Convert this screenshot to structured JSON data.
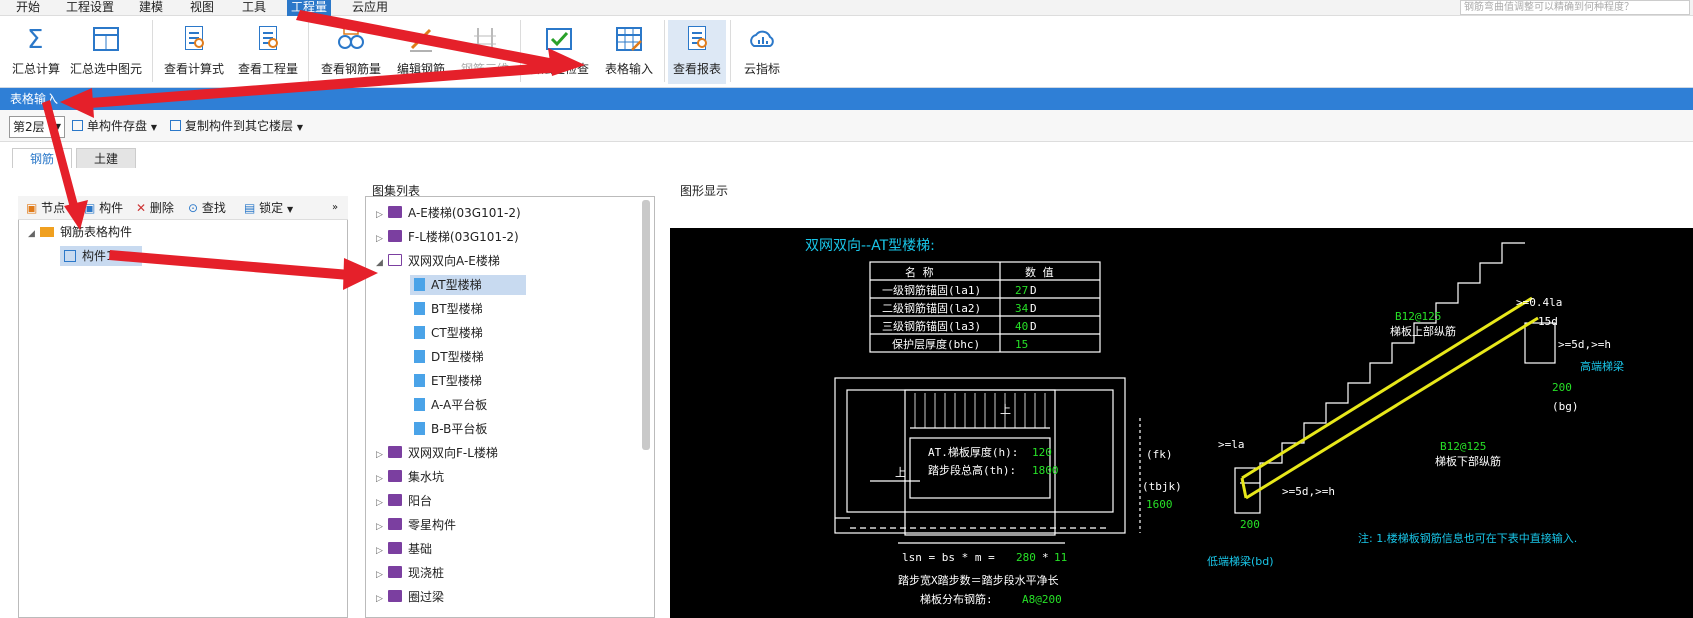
{
  "menu": {
    "items": [
      "开始",
      "工程设置",
      "建模",
      "视图",
      "工具",
      "工程量",
      "云应用"
    ],
    "search_placeholder": "钢筋弯曲值调整可以精确到何种程度？"
  },
  "ribbon": {
    "buttons": [
      "汇总计算",
      "汇总选中图元",
      "查看计算式",
      "查看工程量",
      "查看钢筋量",
      "编辑钢筋",
      "钢筋三维",
      "合法性检查",
      "表格输入",
      "查看报表",
      "云指标"
    ]
  },
  "bluebar": {
    "title": "表格输入"
  },
  "toolbar2": {
    "floor": "第2层",
    "save": "单构件存盘",
    "copy": "复制构件到其它楼层"
  },
  "tabs": {
    "steel": "钢筋",
    "civil": "土建"
  },
  "left": {
    "toolbar": [
      "节点",
      "构件",
      "删除",
      "查找",
      "锁定"
    ],
    "root": "钢筋表格构件",
    "child": "构件1"
  },
  "middle": {
    "title": "图集列表",
    "items": [
      "A-E楼梯(03G101-2)",
      "F-L楼梯(03G101-2)",
      "双网双向A-E楼梯",
      "AT型楼梯",
      "BT型楼梯",
      "CT型楼梯",
      "DT型楼梯",
      "ET型楼梯",
      "A-A平台板",
      "B-B平台板",
      "双网双向F-L楼梯",
      "集水坑",
      "阳台",
      "零星构件",
      "基础",
      "现浇桩",
      "圈过梁"
    ]
  },
  "graph": {
    "title": "图形显示",
    "heading": "双网双向--AT型楼梯:",
    "table_head": [
      "名 称",
      "数 值"
    ],
    "rows": [
      {
        "name": "一级钢筋锚固(la1)",
        "val": "27",
        "unit": "D"
      },
      {
        "name": "二级钢筋锚固(la2)",
        "val": "34",
        "unit": "D"
      },
      {
        "name": "三级钢筋锚固(la3)",
        "val": "40",
        "unit": "D"
      },
      {
        "name": "保护层厚度(bhc)",
        "val": "15",
        "unit": ""
      }
    ],
    "thick_label": "AT.梯板厚度(h):",
    "thick_val": "120",
    "height_label": "踏步段总高(th):",
    "height_val": "1800",
    "fk": "(fk)",
    "tbjk": "(tbjk)",
    "tbjk_val": "1600",
    "up": "上",
    "lsn": "lsn = bs * m = ",
    "bs": "280",
    "m": "11",
    "step_text": "踏步宽X踏步数＝踏步段水平净长",
    "dist_label": "梯板分布钢筋:",
    "dist_val": "A8@200",
    "top_rebar": "B12@125",
    "top_label": "梯板上部纵筋",
    "bot_rebar": "B12@125",
    "bot_label": "梯板下部纵筋",
    "high_beam": "高端梯梁",
    "low_beam": "低端梯梁(bd)",
    "dim_200a": "200",
    "bg": "(bg)",
    "dim_200b": "200",
    "ann1": ">=0.4la",
    "ann2": "15d",
    "ann3": ">=5d,>=h",
    "ann4": ">=la",
    "ann5": ">=5d,>=h",
    "note": "注: 1.楼梯板钢筋信息也可在下表中直接输入."
  }
}
